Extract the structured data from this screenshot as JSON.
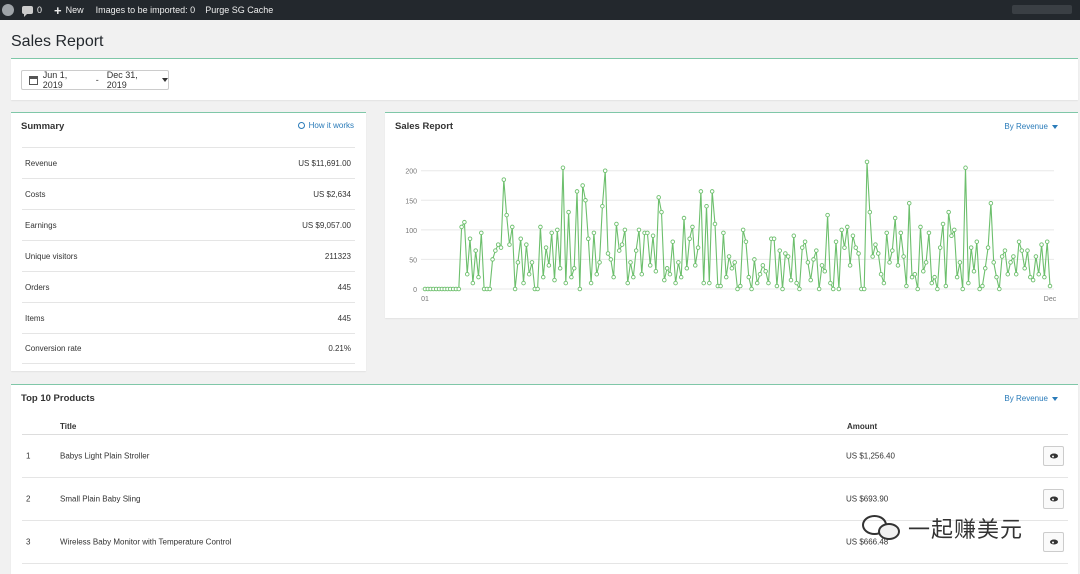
{
  "adminbar": {
    "comments_count": "0",
    "new_label": "New",
    "images_label": "Images to be imported: 0",
    "purge_label": "Purge SG Cache"
  },
  "page": {
    "title": "Sales Report"
  },
  "datefilter": {
    "start": "Jun 1, 2019",
    "separator": "-",
    "end": "Dec 31, 2019"
  },
  "summary": {
    "title": "Summary",
    "how_link": "How it works",
    "rows": [
      {
        "label": "Revenue",
        "value": "US $11,691.00"
      },
      {
        "label": "Costs",
        "value": "US $2,634"
      },
      {
        "label": "Earnings",
        "value": "US $9,057.00"
      },
      {
        "label": "Unique visitors",
        "value": "211323"
      },
      {
        "label": "Orders",
        "value": "445"
      },
      {
        "label": "Items",
        "value": "445"
      },
      {
        "label": "Conversion rate",
        "value": "0.21%"
      }
    ]
  },
  "chart_panel": {
    "title": "Sales Report",
    "by_label": "By Revenue"
  },
  "chart_data": {
    "type": "line",
    "title": "",
    "xlabel": "",
    "ylabel": "",
    "ylim": [
      0,
      230
    ],
    "yticks": [
      0,
      50,
      100,
      150,
      200
    ],
    "grid": true,
    "legend": "none",
    "line_color": "#6dbf6d",
    "x_start_label": "01",
    "x_end_label": "Dec",
    "values": [
      0,
      0,
      0,
      0,
      0,
      0,
      0,
      0,
      0,
      0,
      0,
      0,
      0,
      105,
      113,
      25,
      85,
      10,
      65,
      20,
      95,
      0,
      0,
      0,
      50,
      65,
      75,
      70,
      185,
      125,
      75,
      105,
      0,
      45,
      85,
      10,
      75,
      25,
      45,
      0,
      0,
      105,
      20,
      70,
      40,
      95,
      15,
      100,
      35,
      205,
      10,
      130,
      20,
      35,
      165,
      0,
      175,
      150,
      85,
      10,
      95,
      25,
      45,
      140,
      200,
      60,
      50,
      20,
      110,
      65,
      75,
      100,
      10,
      45,
      20,
      65,
      100,
      25,
      95,
      95,
      40,
      90,
      30,
      155,
      130,
      15,
      35,
      25,
      80,
      10,
      45,
      20,
      120,
      35,
      85,
      105,
      40,
      70,
      165,
      10,
      140,
      10,
      165,
      110,
      5,
      5,
      95,
      20,
      55,
      35,
      45,
      0,
      5,
      100,
      80,
      20,
      0,
      50,
      10,
      25,
      40,
      30,
      10,
      85,
      85,
      5,
      65,
      0,
      60,
      55,
      15,
      90,
      10,
      0,
      70,
      80,
      45,
      15,
      50,
      65,
      0,
      40,
      30,
      125,
      10,
      0,
      80,
      0,
      100,
      70,
      105,
      40,
      90,
      70,
      60,
      0,
      0,
      215,
      130,
      55,
      75,
      60,
      25,
      10,
      95,
      45,
      65,
      120,
      40,
      95,
      55,
      5,
      145,
      20,
      25,
      0,
      105,
      30,
      45,
      95,
      10,
      20,
      0,
      70,
      110,
      5,
      130,
      90,
      100,
      20,
      45,
      0,
      205,
      10,
      70,
      30,
      80,
      0,
      5,
      35,
      70,
      145,
      45,
      20,
      0,
      55,
      65,
      25,
      45,
      55,
      25,
      80,
      65,
      35,
      65,
      20,
      15,
      55,
      25,
      75,
      20,
      80,
      5
    ]
  },
  "top10": {
    "title": "Top 10 Products",
    "by_label": "By Revenue",
    "col_title": "Title",
    "col_amount": "Amount",
    "rows": [
      {
        "rank": "1",
        "title": "Babys Light Plain Stroller",
        "amount": "US $1,256.40"
      },
      {
        "rank": "2",
        "title": "Small Plain Baby Sling",
        "amount": "US $693.90"
      },
      {
        "rank": "3",
        "title": "Wireless Baby Monitor with Temperature Control",
        "amount": "US $666.48"
      }
    ]
  },
  "watermark": {
    "text": "一起赚美元"
  }
}
